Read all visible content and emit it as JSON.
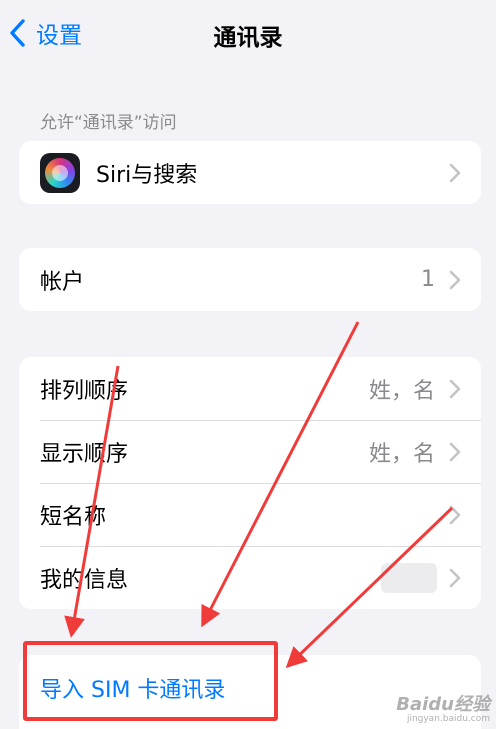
{
  "nav": {
    "back_label": "设置",
    "title": "通讯录"
  },
  "allow_access": {
    "header": "允许“通讯录”访问",
    "siri_label": "Siri与搜索"
  },
  "accounts": {
    "label": "帐户",
    "value": "1"
  },
  "display": {
    "items": [
      {
        "label": "排列顺序",
        "value": "姓，名"
      },
      {
        "label": "显示顺序",
        "value": "姓，名"
      },
      {
        "label": "短名称",
        "value": ""
      },
      {
        "label": "我的信息",
        "value": ""
      }
    ]
  },
  "import": {
    "label": "导入 SIM 卡通讯录"
  },
  "watermark": {
    "main": "Baidu经验",
    "sub": "jingyan.baidu.com"
  },
  "colors": {
    "accent": "#007aff",
    "annotation": "#f03b3b",
    "background": "#f2f2f7"
  },
  "icons": {
    "back": "chevron-left-icon",
    "disclosure": "chevron-right-icon",
    "siri": "siri-icon"
  }
}
